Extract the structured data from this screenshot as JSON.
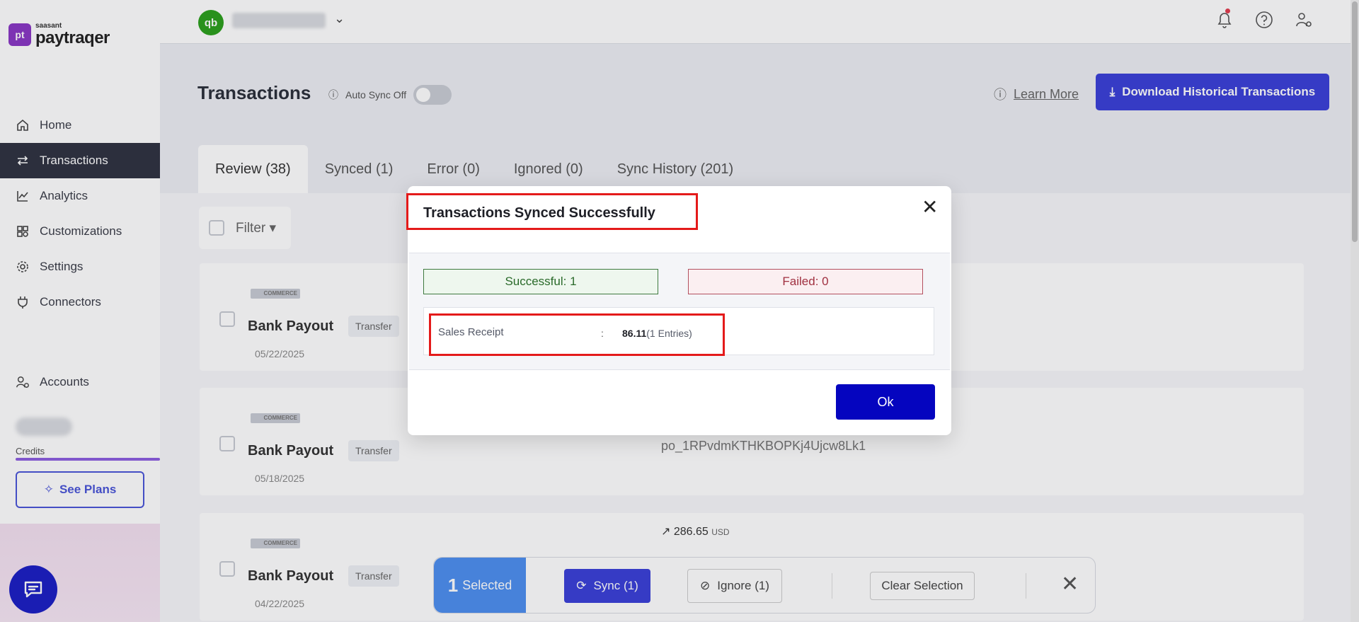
{
  "brand": {
    "logo_mark": "pt",
    "logo_small": "saasant",
    "logo_big": "paytraqer"
  },
  "sidebar": {
    "items": [
      {
        "label": "Home",
        "icon": "home-icon"
      },
      {
        "label": "Transactions",
        "icon": "transfer-icon",
        "active": true
      },
      {
        "label": "Analytics",
        "icon": "analytics-icon"
      },
      {
        "label": "Customizations",
        "icon": "customizations-icon"
      },
      {
        "label": "Settings",
        "icon": "gear-icon"
      },
      {
        "label": "Connectors",
        "icon": "plug-icon"
      }
    ],
    "accounts_label": "Accounts",
    "credits_label": "Credits",
    "see_plans_label": "See Plans"
  },
  "topbar": {
    "qb_logo": "qb",
    "chevron": "⌄"
  },
  "page": {
    "title": "Transactions",
    "auto_sync_label": "Auto Sync Off",
    "learn_more_label": "Learn More",
    "download_label": "Download Historical Transactions"
  },
  "tabs": [
    {
      "label": "Review (38)",
      "active": true
    },
    {
      "label": "Synced (1)"
    },
    {
      "label": "Error (0)"
    },
    {
      "label": "Ignored (0)"
    },
    {
      "label": "Sync History (201)"
    }
  ],
  "filter_label": "Filter",
  "rows": [
    {
      "brand": "COMMERCE",
      "title": "Bank Payout",
      "badge": "Transfer",
      "date": "05/22/2025",
      "amount": "",
      "currency": "",
      "ref": ""
    },
    {
      "brand": "COMMERCE",
      "title": "Bank Payout",
      "badge": "Transfer",
      "date": "05/18/2025",
      "amount": "",
      "currency": "",
      "ref": "po_1RPvdmKTHKBOPKj4Ujcw8Lk1"
    },
    {
      "brand": "COMMERCE",
      "title": "Bank Payout",
      "badge": "Transfer",
      "date": "04/22/2025",
      "amount": "286.65",
      "currency": "USD",
      "ref": ""
    }
  ],
  "action_bar": {
    "selected_count": "1",
    "selected_label": "Selected",
    "sync_label": "Sync (1)",
    "ignore_label": "Ignore (1)",
    "clear_label": "Clear Selection",
    "close": "✕"
  },
  "modal": {
    "title": "Transactions Synced Successfully",
    "close": "✕",
    "successful": "Successful: 1",
    "failed": "Failed: 0",
    "detail_label": "Sales Receipt",
    "detail_colon": ":",
    "detail_value": "86.11",
    "detail_entries": "(1 Entries)",
    "ok_label": "Ok"
  },
  "colors": {
    "accent": "#3a40d9",
    "ok_button": "#0505bf",
    "highlight": "#e41a1a",
    "success": "#2a6a2a",
    "failure": "#a03040"
  }
}
